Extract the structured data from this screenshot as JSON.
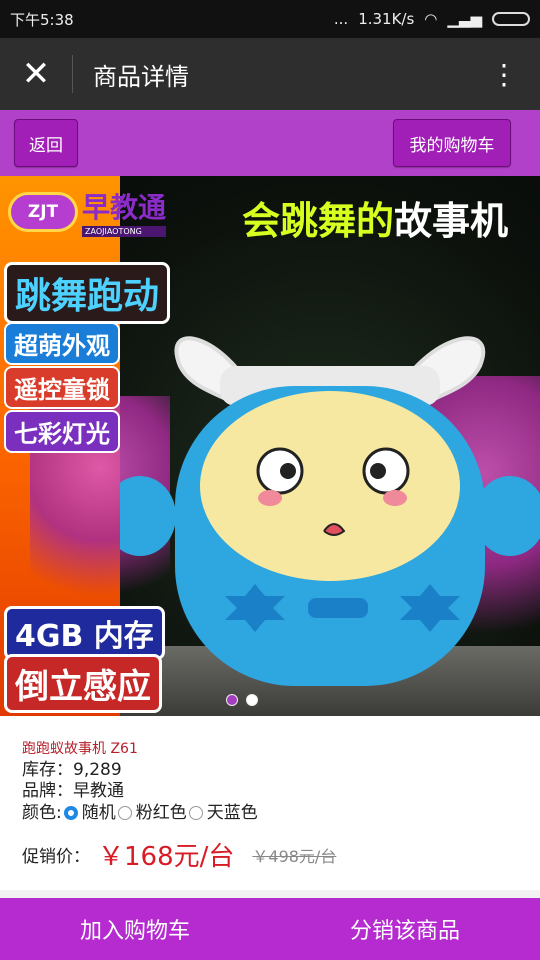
{
  "status": {
    "time": "下午5:38",
    "dots": "...",
    "speed": "1.31K/s"
  },
  "titlebar": {
    "close_glyph": "✕",
    "title": "商品详情",
    "more_glyph": "⋮"
  },
  "nav": {
    "back_label": "返回",
    "cart_label": "我的购物车"
  },
  "banner": {
    "brand_logo": "ZJT",
    "brand_cn": "早教通",
    "brand_en": "ZAOJIAOTONG",
    "headline_a": "会跳舞的",
    "headline_b": "故事机",
    "tags": [
      "跳舞跑动",
      "超萌外观",
      "遥控童锁",
      "七彩灯光",
      "4GB 内存",
      "倒立感应"
    ],
    "carousel_active": 1,
    "carousel_count": 2
  },
  "product": {
    "name": "跑跑蚁故事机 Z61",
    "stock": "库存：9,289",
    "brand": "品牌：早教通",
    "color_label": "颜色:",
    "colors": [
      "随机",
      "粉红色",
      "天蓝色"
    ],
    "selected_color": "随机",
    "price_label": "促销价：",
    "price": "￥168元/台",
    "old_price": "￥498元/台"
  },
  "bottom": {
    "add_cart": "加入购物车",
    "distribute": "分销该商品"
  },
  "colors": {
    "purple": "#b241c9",
    "button": "#a11fb7",
    "price_red": "#d81b24",
    "robot_blue": "#2ea6e0"
  }
}
